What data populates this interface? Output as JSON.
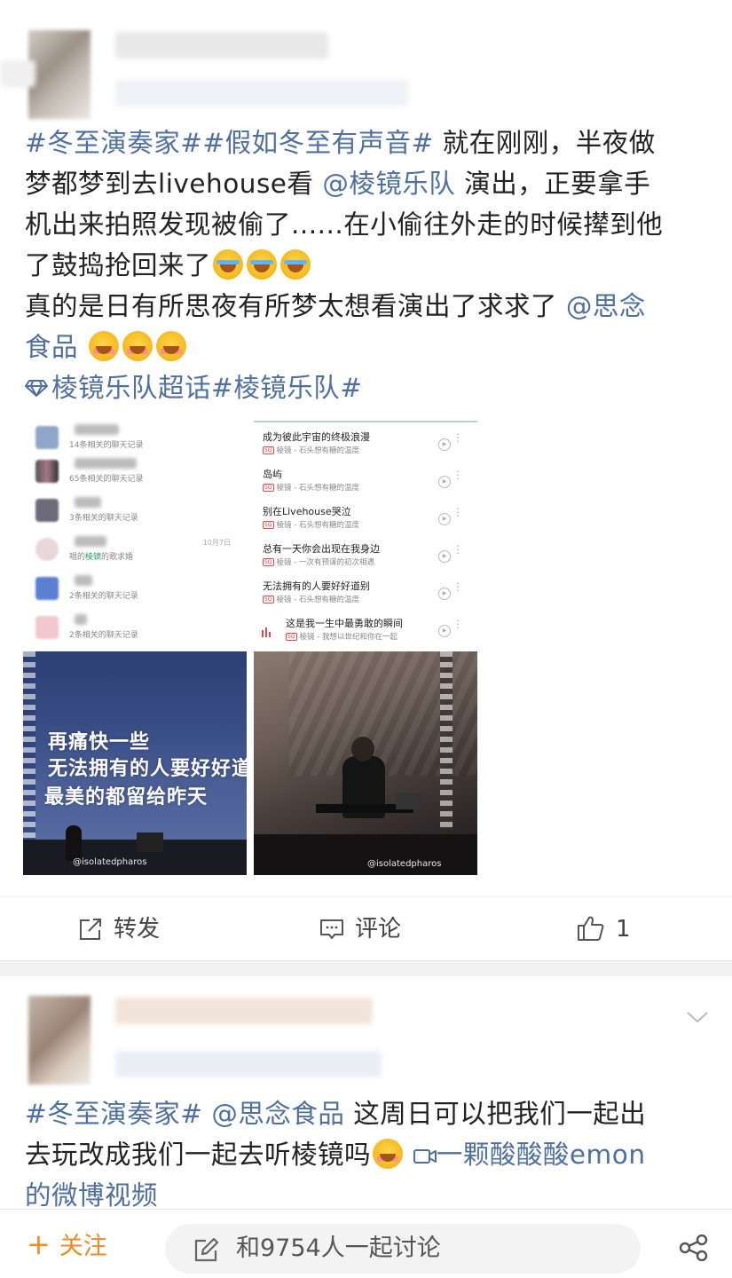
{
  "post1": {
    "line1_tags": "#冬至演奏家##假如冬至有声音#",
    "line1_text": " 就在刚刚，半夜做",
    "line2_text": "梦都梦到去livehouse看",
    "line2_mention": "@棱镜乐队",
    "line2_text_b": " 演出，正要拿手",
    "line3_text": "机出来拍照发现被偷了......在小偷往外走的时候撵到他",
    "line4_text": "了鼓捣抢回来了",
    "line5_text": "真的是日有所思夜有所梦太想看演出了求求了",
    "line5_mention": "@思念",
    "line6_mention": "食品",
    "line7_supertopic": "棱镜乐队超话",
    "line7_tag": "#棱镜乐队#",
    "chat_image": {
      "rows": [
        {
          "sub": "14条相关的聊天记录",
          "date": ""
        },
        {
          "sub": "65条相关的聊天记录",
          "date": ""
        },
        {
          "sub": "3条相关的聊天记录",
          "date": ""
        },
        {
          "sub_a": "唱的",
          "sub_hl": "棱镜",
          "sub_b": "的歌求婚",
          "date": "10月7日"
        },
        {
          "sub": "2条相关的聊天记录",
          "date": ""
        },
        {
          "sub": "2条相关的聊天记录",
          "date": ""
        }
      ]
    },
    "songs_image": {
      "badge": "SQ",
      "songs": [
        {
          "title": "成为彼此宇宙的终极浪漫",
          "sub": "棱镜 - 石头想有糖的温度"
        },
        {
          "title": "岛屿",
          "sub": "棱镜 - 石头想有糖的温度"
        },
        {
          "title": "别在Livehouse哭泣",
          "sub": "棱镜 - 石头想有糖的温度"
        },
        {
          "title": "总有一天你会出现在我身边",
          "sub": "棱镜 - 一次有预谋的初次相遇"
        },
        {
          "title": "无法拥有的人要好好道别",
          "sub": "棱镜 - 石头想有糖的温度"
        },
        {
          "title": "这是我一生中最勇敢的瞬间",
          "sub": "棱镜 - 我想以世纪和你在一起"
        }
      ]
    },
    "stage1": {
      "line1": "再痛快一些",
      "line2": "无法拥有的人要好好道",
      "line3": "最美的都留给昨天",
      "watermark": "@isolatedpharos"
    },
    "stage2": {
      "watermark": "@isolatedpharos"
    },
    "actions": {
      "repost": "转发",
      "comment": "评论",
      "like": "1"
    }
  },
  "post2": {
    "line1_tags": "#冬至演奏家#",
    "line1_mention": " @思念食品",
    "line1_text": " 这周日可以把我们一起出",
    "line2_text": "去玩改成我们一起去听棱镜吗",
    "line2_video": "一颗酸酸酸emon",
    "line3_video": "的微博视频"
  },
  "bottom": {
    "follow": "关注",
    "discuss": "和9754人一起讨论"
  },
  "colors": {
    "link": "#4f6fa0",
    "follow": "#f08a24"
  }
}
